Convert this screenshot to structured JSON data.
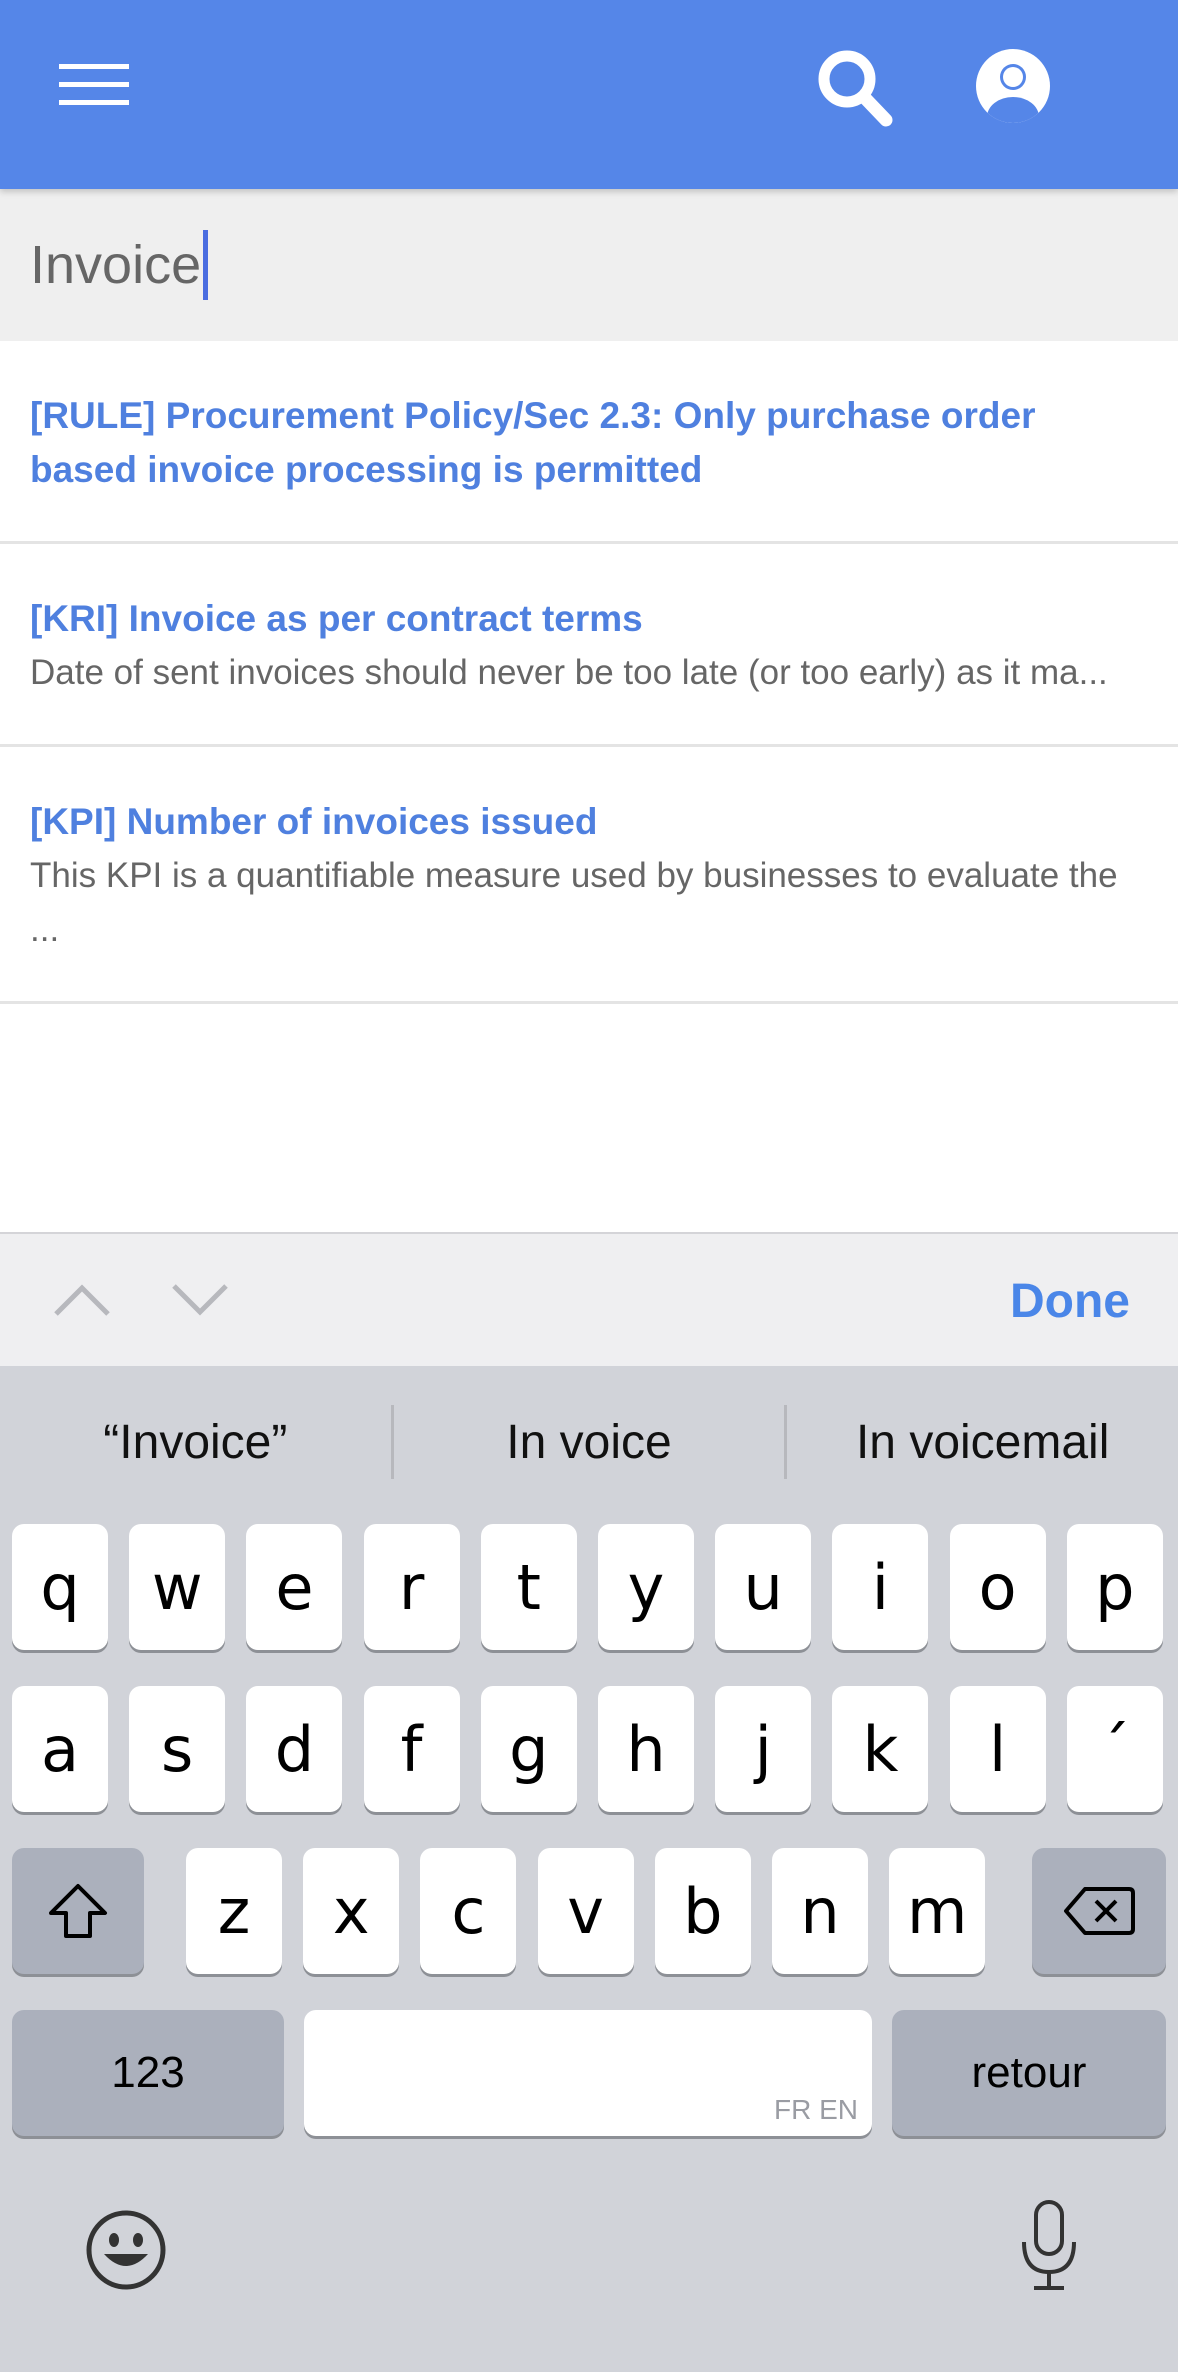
{
  "header": {
    "menu_icon": "hamburger-menu-icon",
    "search_icon": "magnifier-icon",
    "account_icon": "user-circle-icon",
    "accent_color": "#5586e8"
  },
  "search": {
    "value": "Invoice"
  },
  "results": [
    {
      "title": "[RULE] Procurement Policy/Sec 2.3: Only purchase order based invoice processing is permitted",
      "description": ""
    },
    {
      "title": "[KRI] Invoice as per contract terms",
      "description": "Date of sent invoices should never be too late (or too early) as it ma..."
    },
    {
      "title": "[KPI] Number of invoices issued",
      "description": "This KPI is a quantifiable measure used by businesses to evaluate the ..."
    }
  ],
  "toolbar": {
    "done_label": "Done"
  },
  "keyboard": {
    "suggestions": [
      "“Invoice”",
      "In voice",
      "In voicemail"
    ],
    "row1": [
      "q",
      "w",
      "e",
      "r",
      "t",
      "y",
      "u",
      "i",
      "o",
      "p"
    ],
    "row2": [
      "a",
      "s",
      "d",
      "f",
      "g",
      "h",
      "j",
      "k",
      "l",
      "´"
    ],
    "row3": [
      "z",
      "x",
      "c",
      "v",
      "b",
      "n",
      "m"
    ],
    "numbers_label": "123",
    "return_label": "retour",
    "space_language": "FR EN"
  }
}
